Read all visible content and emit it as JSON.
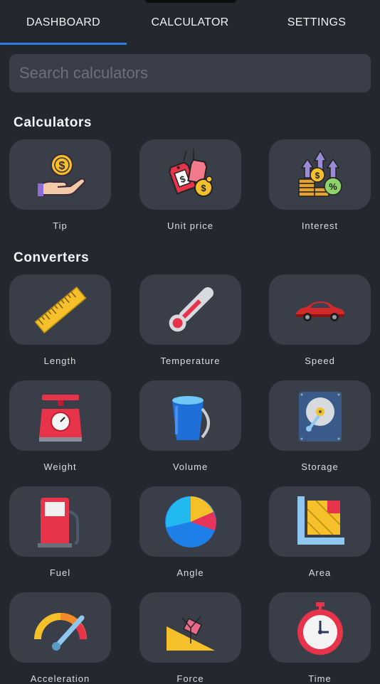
{
  "tabs": [
    {
      "label": "DASHBOARD"
    },
    {
      "label": "CALCULATOR"
    },
    {
      "label": "SETTINGS"
    }
  ],
  "search": {
    "placeholder": "Search calculators"
  },
  "sections": {
    "calculators": {
      "title": "Calculators",
      "items": [
        {
          "label": "Tip",
          "icon": "tip-icon"
        },
        {
          "label": "Unit price",
          "icon": "price-tag-icon"
        },
        {
          "label": "Interest",
          "icon": "interest-icon"
        }
      ]
    },
    "converters": {
      "title": "Converters",
      "items": [
        {
          "label": "Length",
          "icon": "ruler-icon"
        },
        {
          "label": "Temperature",
          "icon": "thermometer-icon"
        },
        {
          "label": "Speed",
          "icon": "car-icon"
        },
        {
          "label": "Weight",
          "icon": "scale-icon"
        },
        {
          "label": "Volume",
          "icon": "bucket-icon"
        },
        {
          "label": "Storage",
          "icon": "hard-drive-icon"
        },
        {
          "label": "Fuel",
          "icon": "fuel-pump-icon"
        },
        {
          "label": "Angle",
          "icon": "pie-icon"
        },
        {
          "label": "Area",
          "icon": "area-icon"
        },
        {
          "label": "Acceleration",
          "icon": "gauge-icon"
        },
        {
          "label": "Force",
          "icon": "incline-icon"
        },
        {
          "label": "Time",
          "icon": "stopwatch-icon"
        }
      ]
    }
  },
  "colors": {
    "background": "#24272e",
    "tile": "#3a3e48",
    "accent": "#2f7fe8"
  }
}
